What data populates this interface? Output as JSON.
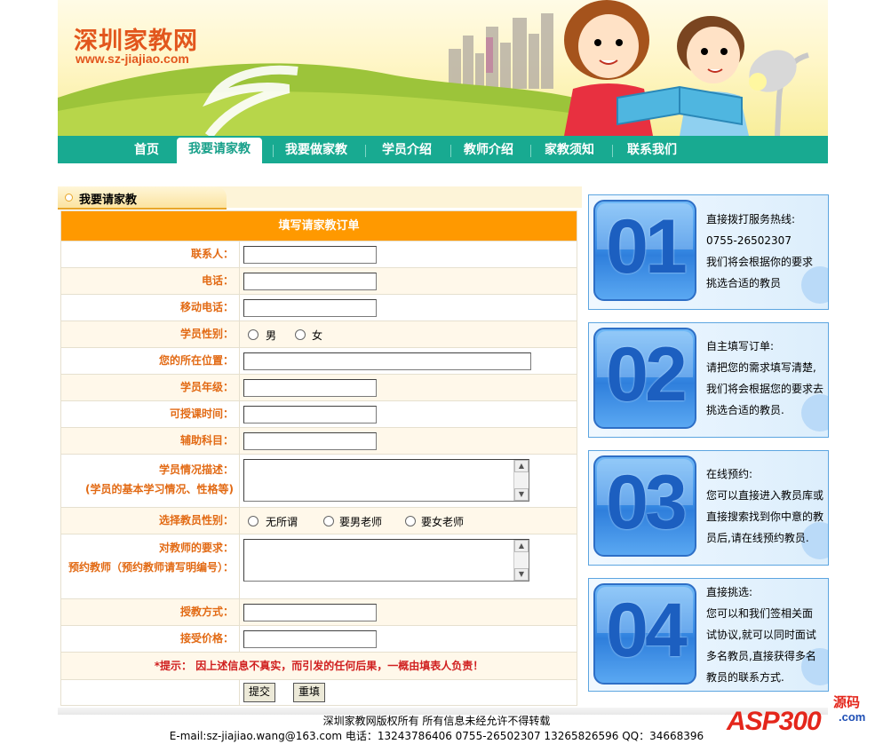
{
  "brand": {
    "name_cn": "深圳家教网",
    "url": "www.sz-jiajiao.com"
  },
  "nav": {
    "items": [
      "首页",
      "我要请家教",
      "我要做家教",
      "学员介绍",
      "教师介绍",
      "家教须知",
      "联系我们"
    ],
    "active": "我要请家教"
  },
  "section": {
    "title": "我要请家教"
  },
  "form": {
    "header": "填写请家教订单",
    "fields": {
      "contact": "联系人：",
      "phone": "电话：",
      "mobile": "移动电话：",
      "gender": "学员性别：",
      "location": "您的所在位置：",
      "grade": "学员年级：",
      "time": "可授课时间：",
      "subject": "辅助科目：",
      "desc": "学员情况描述：",
      "desc_sub": "(学员的基本学习情况、性格等)",
      "teacher_gender": "选择教员性别：",
      "req": "对教师的要求：",
      "req_sub": "预约教师（预约教师请写明编号）：",
      "mode": "授教方式：",
      "price": "接受价格："
    },
    "gender_options": [
      "男",
      "女"
    ],
    "teacher_gender_options": [
      "无所谓",
      "要男老师",
      "要女老师"
    ],
    "tip_label": "*提示：",
    "tip_text": "因上述信息不真实，而引发的任何后果，一概由填表人负责！",
    "submit": "提交",
    "reset": "重填"
  },
  "steps": [
    {
      "num": "01",
      "lines": [
        "直接拨打服务热线:",
        "0755-26502307",
        "我们将会根据你的要求",
        "挑选合适的教员"
      ]
    },
    {
      "num": "02",
      "lines": [
        "自主填写订单:",
        "请把您的需求填写清楚,",
        "我们将会根据您的要求去",
        "挑选合适的教员."
      ]
    },
    {
      "num": "03",
      "lines": [
        "在线预约:",
        "您可以直接进入教员库或",
        "直接搜索找到你中意的教",
        "员后,请在线预约教员."
      ]
    },
    {
      "num": "04",
      "lines": [
        "直接挑选:",
        "您可以和我们签相关面",
        "试协议,就可以同时面试",
        "多名教员,直接获得多名",
        "教员的联系方式."
      ]
    }
  ],
  "footer": {
    "copyright": "深圳家教网版权所有  所有信息未经允许不得转载",
    "contact": "E-mail:sz-jiajiao.wang@163.com  电话：13243786406  0755-26502307  13265826596  QQ：34668396"
  },
  "watermark": {
    "brand": "ASP300",
    "suffix": ".com",
    "tag": "源码"
  },
  "colors": {
    "nav": "#18aa91",
    "form_header": "#ff9900",
    "label": "#e26a14",
    "tip": "#d02020",
    "brand": "#e2561d"
  }
}
